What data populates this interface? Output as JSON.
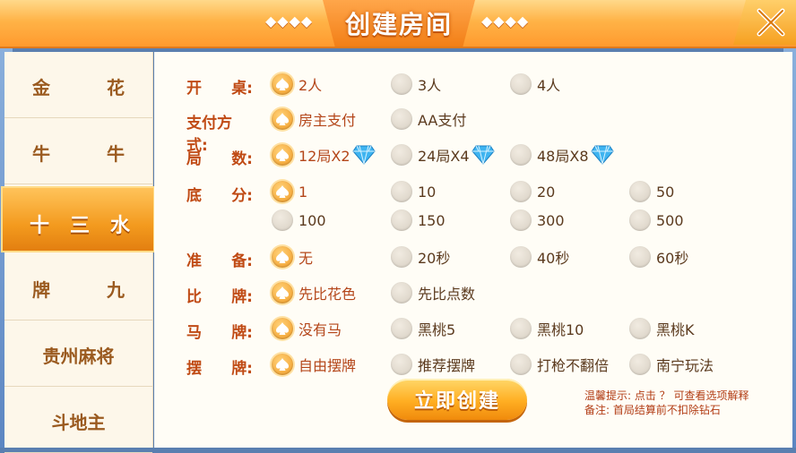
{
  "title": {
    "text": "创建房间",
    "deco_left": "◆◆◆◆",
    "deco_right": "◆◆◆◆"
  },
  "sidebar": {
    "tabs": [
      {
        "label_a": "金",
        "label_b": "花",
        "active": false
      },
      {
        "label_a": "牛",
        "label_b": "牛",
        "active": false
      },
      {
        "label_a": "十",
        "label_m": "三",
        "label_b": "水",
        "active": true
      },
      {
        "label_a": "牌",
        "label_b": "九",
        "active": false
      },
      {
        "label": "贵州麻将",
        "active": false
      },
      {
        "label": "斗地主",
        "active": false
      }
    ]
  },
  "options": {
    "table": {
      "label_a": "开",
      "label_b": "桌:",
      "choices": [
        "2人",
        "3人",
        "4人"
      ],
      "selected": 0
    },
    "payment": {
      "label": "支付方式:",
      "choices": [
        "房主支付",
        "AA支付"
      ],
      "selected": 0
    },
    "rounds": {
      "label_a": "局",
      "label_b": "数:",
      "choices": [
        "12局X2",
        "24局X4",
        "48局X8"
      ],
      "selected": 0
    },
    "base": {
      "label_a": "底",
      "label_b": "分:",
      "choices": [
        "1",
        "10",
        "20",
        "50",
        "100",
        "150",
        "300",
        "500"
      ],
      "selected": 0
    },
    "ready": {
      "label_a": "准",
      "label_b": "备:",
      "choices": [
        "无",
        "20秒",
        "40秒",
        "60秒"
      ],
      "selected": 0
    },
    "compare": {
      "label_a": "比",
      "label_b": "牌:",
      "choices": [
        "先比花色",
        "先比点数"
      ],
      "selected": 0
    },
    "horse": {
      "label_a": "马",
      "label_b": "牌:",
      "choices": [
        "没有马",
        "黑桃5",
        "黑桃10",
        "黑桃K"
      ],
      "selected": 0
    },
    "arrange": {
      "label_a": "摆",
      "label_b": "牌:",
      "choices": [
        "自由摆牌",
        "推荐摆牌",
        "打枪不翻倍",
        "南宁玩法"
      ],
      "selected": 0
    }
  },
  "create_button": "立即创建",
  "tips": {
    "line1": "温馨提示: 点击 ？ 可查看选项解释",
    "line2": "备注: 首局结算前不扣除钻石"
  },
  "colors": {
    "accent": "#f39a1e",
    "label": "#c04a14",
    "gem": "#3fb4f0"
  }
}
